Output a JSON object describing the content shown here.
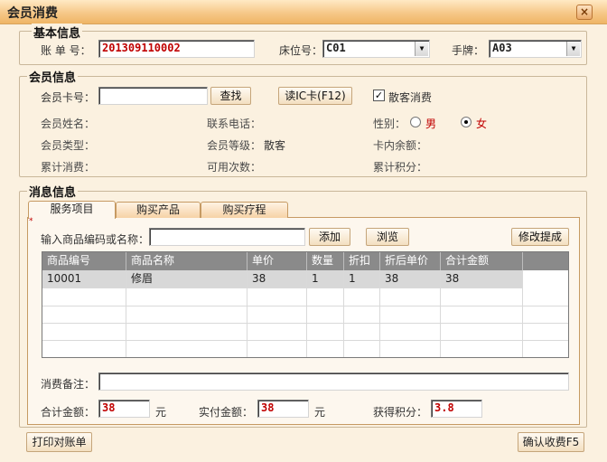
{
  "window": {
    "title": "会员消费",
    "close_glyph": "×"
  },
  "basic": {
    "section_title": "基本信息",
    "account_label": "账 单 号：",
    "account_value": "201309110002",
    "bed_label": "床位号：",
    "bed_value": "C01",
    "wristband_label": "手牌：",
    "wristband_value": "A03"
  },
  "member": {
    "section_title": "会员信息",
    "card_label": "会员卡号：",
    "card_value": "",
    "search_button": "查找",
    "read_ic_button": "读IC卡(F12)",
    "walkin_checkbox_label": "散客消费",
    "walkin_checked": "✓",
    "name_label": "会员姓名：",
    "phone_label": "联系电话：",
    "gender_label": "性别：",
    "gender_male": "男",
    "gender_female": "女",
    "type_label": "会员类型：",
    "level_label": "会员等级：",
    "level_value": "散客",
    "card_balance_label": "卡内余额：",
    "total_spent_label": "累计消费：",
    "available_times_label": "可用次数：",
    "total_points_label": "累计积分："
  },
  "consume": {
    "section_title": "消息信息",
    "tabs": [
      "服务项目",
      "购买产品",
      "购买疗程"
    ],
    "marker": "*",
    "product_input_label": "输入商品编码或名称：",
    "product_input_value": "",
    "add_button": "添加",
    "browse_button": "浏览",
    "modify_commission_button": "修改提成",
    "table": {
      "headers": [
        "商品编号",
        "商品名称",
        "单价",
        "数量",
        "折扣",
        "折后单价",
        "合计金额",
        ""
      ],
      "rows": [
        [
          "10001",
          "修眉",
          "38",
          "1",
          "1",
          "38",
          "38",
          ""
        ]
      ]
    },
    "remark_label": "消费备注：",
    "remark_value": "",
    "total_label": "合计金额：",
    "total_value": "38",
    "yuan": "元",
    "paid_label": "实付金额：",
    "paid_value": "38",
    "yuan2": "元",
    "points_label": "获得积分：",
    "points_value": "3.8"
  },
  "footer": {
    "print_button": "打印对账单",
    "confirm_button": "确认收费F5"
  },
  "colors": {
    "title_gradient_top": "#ffe9c4",
    "accent_red": "#c00000",
    "background": "#fbf1e0"
  }
}
